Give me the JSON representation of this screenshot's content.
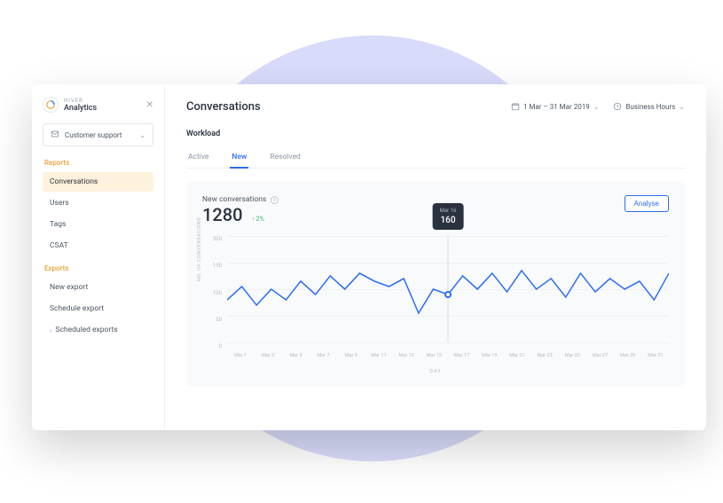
{
  "brand": {
    "line1": "HIVER",
    "line2": "Analytics"
  },
  "selector": {
    "icon": "inbox",
    "label": "Customer support"
  },
  "sections": {
    "reports": {
      "label": "Reports",
      "items": [
        "Conversations",
        "Users",
        "Tags",
        "CSAT"
      ],
      "active_index": 0
    },
    "exports": {
      "label": "Exports",
      "items": [
        "New export",
        "Schedule export",
        "Scheduled exports"
      ],
      "chevron_index": 2
    }
  },
  "page": {
    "title": "Conversations"
  },
  "header": {
    "date_range": "1 Mar – 31 Mar 2019",
    "hours": "Business Hours"
  },
  "workload": {
    "label": "Workload",
    "tabs": [
      "Active",
      "New",
      "Resolved"
    ],
    "active_tab": 1
  },
  "chart": {
    "title": "New conversations",
    "total": "1280",
    "delta": "↑ 2%",
    "analyse": "Analyse",
    "ylabel": "NO. OF CONVERSATIONS",
    "xlabel": "DAY",
    "y_ticks": [
      "200",
      "150",
      "100",
      "50",
      "0"
    ],
    "tooltip": {
      "date": "Mar 16",
      "value": "160"
    }
  },
  "chart_data": {
    "type": "line",
    "title": "New conversations",
    "xlabel": "DAY",
    "ylabel": "NO. OF CONVERSATIONS",
    "ylim": [
      0,
      200
    ],
    "categories": [
      "Mar 1",
      "Mar 2",
      "Mar 3",
      "Mar 4",
      "Mar 5",
      "Mar 6",
      "Mar 7",
      "Mar 8",
      "Mar 9",
      "Mar 10",
      "Mar 11",
      "Mar 12",
      "Mar 13",
      "Mar 14",
      "Mar 15",
      "Mar 16",
      "Mar 17",
      "Mar 18",
      "Mar 19",
      "Mar 20",
      "Mar 21",
      "Mar 22",
      "Mar 23",
      "Mar 24",
      "Mar 25",
      "Mar 26",
      "Mar 27",
      "Mar 28",
      "Mar 29",
      "Mar 30",
      "Mar 31"
    ],
    "x_tick_labels": [
      "Mar 1",
      "Mar 3",
      "Mar 5",
      "Mar 7",
      "Mar 9",
      "Mar 11",
      "Mar 13",
      "Mar 15",
      "Mar 17",
      "Mar 19",
      "Mar 21",
      "Mar 23",
      "Mar 25",
      "Mar 27",
      "Mar 29",
      "Mar 31"
    ],
    "values": [
      80,
      105,
      70,
      100,
      80,
      115,
      90,
      125,
      100,
      130,
      115,
      105,
      120,
      55,
      100,
      90,
      125,
      100,
      130,
      95,
      135,
      100,
      120,
      85,
      130,
      95,
      120,
      100,
      115,
      80,
      130
    ],
    "highlight": {
      "index": 15,
      "date": "Mar 16",
      "value": 160
    },
    "total": 1280,
    "delta_pct": 2
  },
  "colors": {
    "accent": "#2a6df4",
    "warm": "#e9a23b",
    "tooltip_bg": "#2a3240"
  }
}
